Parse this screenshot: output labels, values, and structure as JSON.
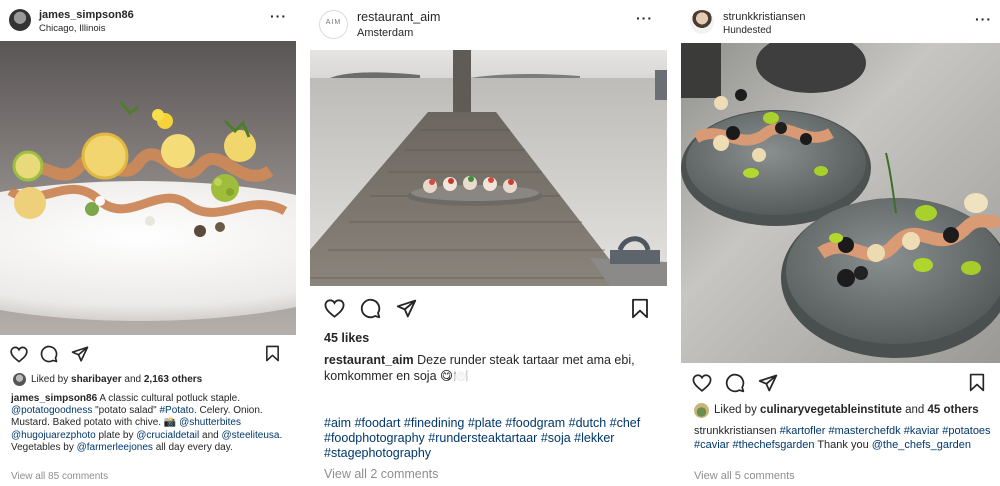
{
  "posts": [
    {
      "username": "james_simpson86",
      "location": "Chicago, Illinois",
      "more_icon": "more-horizontal-icon",
      "liked_by_prefix": "Liked by",
      "liked_by_user": "sharibayer",
      "liked_by_and": "and",
      "liked_by_others": "2,163 others",
      "caption_user": "james_simpson86",
      "caption_text_1": "A classic cultural potluck staple.",
      "caption_tag_1": "@potatogoodness",
      "caption_text_2": "\"potato salad\"",
      "caption_tag_2": "#Potato",
      "caption_text_3": ". Celery. Onion. Mustard. Baked potato with chive. 📸",
      "caption_tag_3": "@shutterbites",
      "caption_tag_4": "@hugojuarezphoto",
      "caption_text_4": "plate by",
      "caption_tag_5": "@crucialdetail",
      "caption_text_5": "and",
      "caption_tag_6": "@steeliteusa",
      "caption_text_6": ". Vegetables by",
      "caption_tag_7": "@farmerleejones",
      "caption_text_7": "all day every day.",
      "comments": "View all 85 comments"
    },
    {
      "username": "restaurant_aim",
      "location": "Amsterdam",
      "avatar_text": "AIM",
      "likes": "45 likes",
      "caption_user": "restaurant_aim",
      "caption_text": "Deze runder steak tartaar met ama ebi, komkommer en soja 😋🍽️",
      "hashtags": "#aim #foodart #finedining #plate #foodgram #dutch #chef #foodphotography #rundersteaktartaar #soja #lekker #stagephotography",
      "comments": "View all 2 comments"
    },
    {
      "username": "strunkkristiansen",
      "location": "Hundested",
      "liked_by_prefix": "Liked by",
      "liked_by_user": "culinaryvegetableinstitute",
      "liked_by_and": "and",
      "liked_by_others": "45 others",
      "caption_user": "strunkkristiansen",
      "caption_tags_1": "#kartofler #masterchefdk #kaviar #potatoes #caviar #thechefsgarden",
      "caption_text": "Thank you",
      "caption_tag_2": "@the_chefs_garden",
      "comments": "View all 5 comments"
    }
  ],
  "icons": [
    "heart-icon",
    "comment-icon",
    "share-icon",
    "bookmark-icon"
  ],
  "colors": {
    "text": "#262626",
    "link": "#00376b",
    "muted": "#8e8e8e"
  }
}
